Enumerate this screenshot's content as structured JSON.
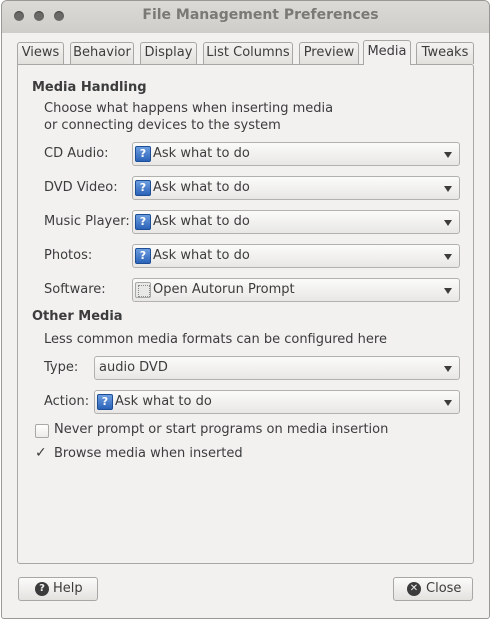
{
  "window": {
    "title": "File Management Preferences"
  },
  "tabs": [
    {
      "label": "Views"
    },
    {
      "label": "Behavior"
    },
    {
      "label": "Display"
    },
    {
      "label": "List Columns"
    },
    {
      "label": "Preview"
    },
    {
      "label": "Media",
      "active": true
    },
    {
      "label": "Tweaks"
    }
  ],
  "media_handling": {
    "title": "Media Handling",
    "desc_line1": "Choose what happens when inserting media",
    "desc_line2": "or connecting devices to the system",
    "rows": [
      {
        "label": "CD Audio:",
        "value": "Ask what to do",
        "icon": "help-icon"
      },
      {
        "label": "DVD Video:",
        "value": "Ask what to do",
        "icon": "help-icon"
      },
      {
        "label": "Music Player:",
        "value": "Ask what to do",
        "icon": "help-icon"
      },
      {
        "label": "Photos:",
        "value": "Ask what to do",
        "icon": "help-icon"
      },
      {
        "label": "Software:",
        "value": "Open Autorun Prompt",
        "icon": "program-icon"
      }
    ]
  },
  "other_media": {
    "title": "Other Media",
    "desc": "Less common media formats can be configured here",
    "type_label": "Type:",
    "type_value": "audio DVD",
    "action_label": "Action:",
    "action_value": "Ask what to do",
    "action_icon": "help-icon"
  },
  "options": {
    "never_prompt": {
      "label": "Never prompt or start programs on media insertion",
      "checked": false
    },
    "browse_media": {
      "label": "Browse media when inserted",
      "checked": true
    }
  },
  "buttons": {
    "help_label": "Help",
    "help_icon": "help-icon",
    "close_label": "Close",
    "close_icon": "close-icon"
  },
  "colors": {
    "window_bg": "#f2f1f0",
    "titlebar": "#d6d4d0",
    "help_icon_blue": "#2b63b8"
  }
}
